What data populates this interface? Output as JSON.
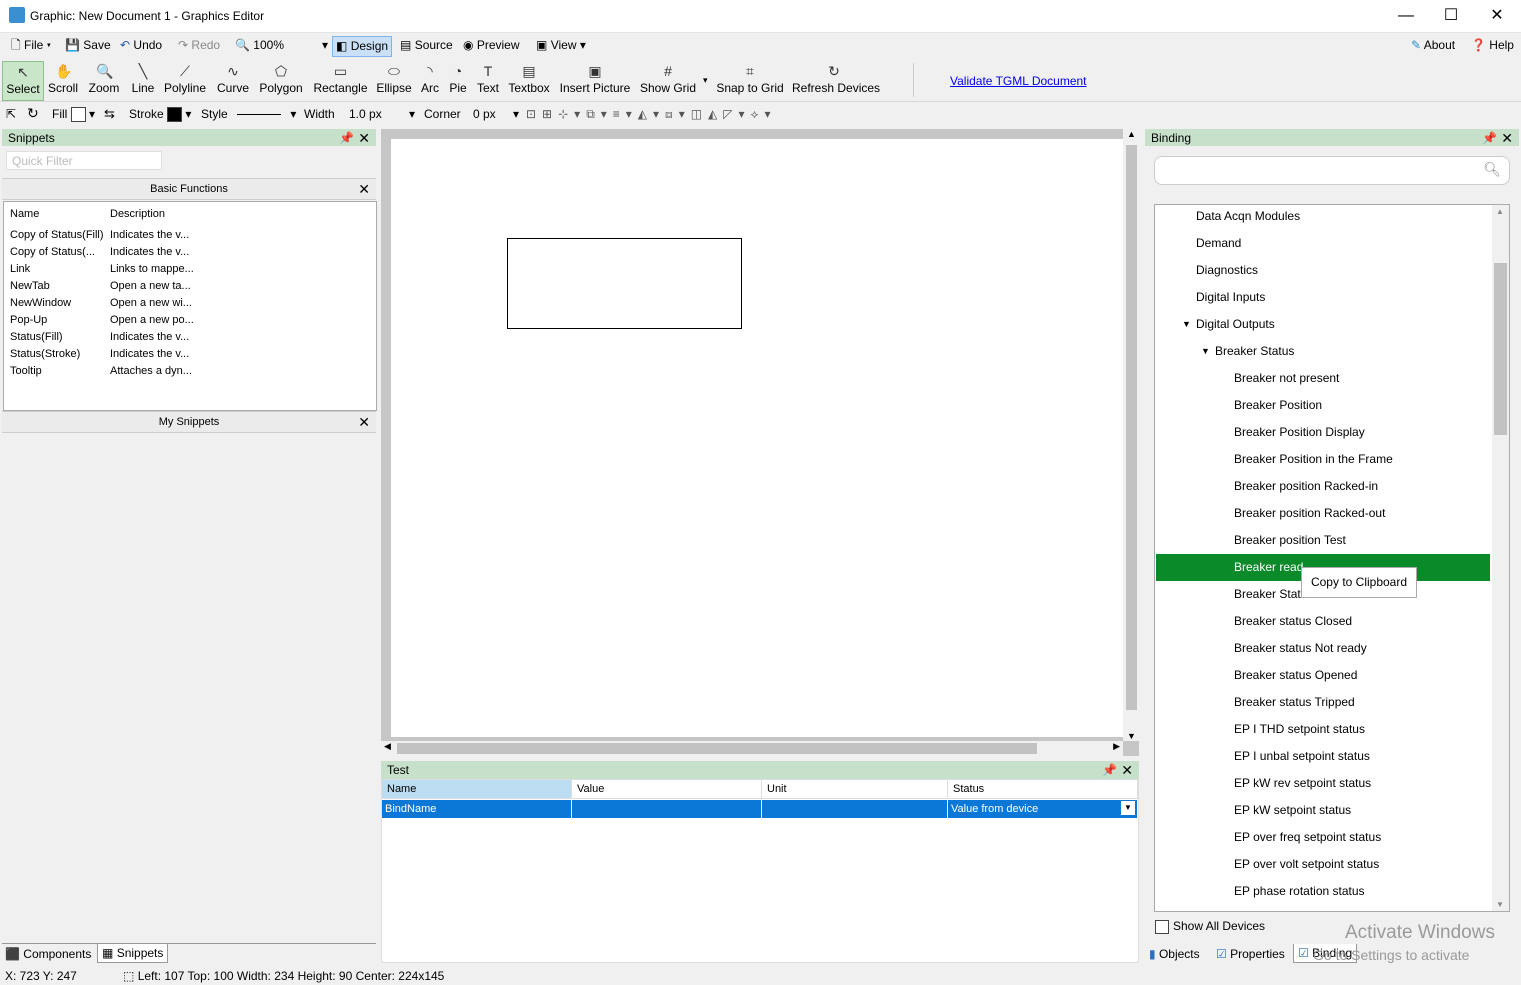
{
  "window": {
    "title": "Graphic: New Document 1 - Graphics Editor",
    "min": "—",
    "max": "☐",
    "close": "✕"
  },
  "menu": {
    "file": "File",
    "save": "Save",
    "undo": "Undo",
    "redo": "Redo",
    "zoom": "100%",
    "design": "Design",
    "source": "Source",
    "preview": "Preview",
    "view": "View",
    "about": "About",
    "help": "Help"
  },
  "tools": [
    {
      "label": "Select",
      "icon": "↖"
    },
    {
      "label": "Scroll",
      "icon": "✋"
    },
    {
      "label": "Zoom",
      "icon": "🔍"
    },
    {
      "label": "Line",
      "icon": "╲"
    },
    {
      "label": "Polyline",
      "icon": "⟋"
    },
    {
      "label": "Curve",
      "icon": "∿"
    },
    {
      "label": "Polygon",
      "icon": "⬠"
    },
    {
      "label": "Rectangle",
      "icon": "▭"
    },
    {
      "label": "Ellipse",
      "icon": "⬭"
    },
    {
      "label": "Arc",
      "icon": "◝"
    },
    {
      "label": "Pie",
      "icon": "◔"
    },
    {
      "label": "Text",
      "icon": "T"
    },
    {
      "label": "Textbox",
      "icon": "▤"
    },
    {
      "label": "Insert Picture",
      "icon": "▣"
    },
    {
      "label": "Show Grid",
      "icon": "#"
    },
    {
      "label": "Snap to Grid",
      "icon": "⌗"
    },
    {
      "label": "Refresh Devices",
      "icon": "↻"
    }
  ],
  "validate_link": "Validate TGML Document",
  "props": {
    "fill": "Fill",
    "stroke": "Stroke",
    "style": "Style",
    "width_label": "Width",
    "width_value": "1.0 px",
    "corner_label": "Corner",
    "corner_value": "0 px"
  },
  "snippets": {
    "title": "Snippets",
    "filter_placeholder": "Quick Filter",
    "basic_functions": "Basic Functions",
    "col_name": "Name",
    "col_desc": "Description",
    "rows": [
      {
        "name": "Copy of Status(Fill)",
        "desc": "Indicates the v..."
      },
      {
        "name": "Copy of Status(...",
        "desc": "Indicates the v..."
      },
      {
        "name": "Link",
        "desc": "Links to mappe..."
      },
      {
        "name": "NewTab",
        "desc": "Open a new ta..."
      },
      {
        "name": "NewWindow",
        "desc": "Open a new wi..."
      },
      {
        "name": "Pop-Up",
        "desc": "Open a new po..."
      },
      {
        "name": "Status(Fill)",
        "desc": "Indicates the v..."
      },
      {
        "name": "Status(Stroke)",
        "desc": "Indicates the v..."
      },
      {
        "name": "Tooltip",
        "desc": "Attaches a dyn..."
      }
    ],
    "my_snippets": "My Snippets"
  },
  "left_tabs": {
    "components": "Components",
    "snippets": "Snippets"
  },
  "test": {
    "title": "Test",
    "cols": [
      "Name",
      "Value",
      "Unit",
      "Status"
    ],
    "row": {
      "name": "BindName",
      "value": "",
      "unit": "",
      "status": "Value from device"
    }
  },
  "binding": {
    "title": "Binding",
    "tree": [
      {
        "label": "Data Acqn Modules",
        "level": 0,
        "expanded": false
      },
      {
        "label": "Demand",
        "level": 0,
        "expanded": false
      },
      {
        "label": "Diagnostics",
        "level": 0,
        "expanded": false
      },
      {
        "label": "Digital Inputs",
        "level": 0,
        "expanded": false
      },
      {
        "label": "Digital Outputs",
        "level": 0,
        "expanded": true
      },
      {
        "label": "Breaker Status",
        "level": 1,
        "expanded": true
      },
      {
        "label": "Breaker not present",
        "level": 2
      },
      {
        "label": "Breaker Position",
        "level": 2
      },
      {
        "label": "Breaker Position Display",
        "level": 2
      },
      {
        "label": "Breaker Position in the Frame",
        "level": 2
      },
      {
        "label": "Breaker position Racked-in",
        "level": 2
      },
      {
        "label": "Breaker position Racked-out",
        "level": 2
      },
      {
        "label": "Breaker position Test",
        "level": 2
      },
      {
        "label": "Breaker read",
        "level": 2,
        "selected": true
      },
      {
        "label": "Breaker Stat",
        "level": 2
      },
      {
        "label": "Breaker status Closed",
        "level": 2
      },
      {
        "label": "Breaker status Not ready",
        "level": 2
      },
      {
        "label": "Breaker status Opened",
        "level": 2
      },
      {
        "label": "Breaker status Tripped",
        "level": 2
      },
      {
        "label": "EP I THD setpoint status",
        "level": 2
      },
      {
        "label": "EP I unbal setpoint status",
        "level": 2
      },
      {
        "label": "EP kW rev setpoint status",
        "level": 2
      },
      {
        "label": "EP kW setpoint status",
        "level": 2
      },
      {
        "label": "EP over freq setpoint status",
        "level": 2
      },
      {
        "label": "EP over volt setpoint status",
        "level": 2
      },
      {
        "label": "EP phase rotation status",
        "level": 2
      }
    ],
    "tooltip": "Copy to Clipboard",
    "show_all_devices": "Show All Devices"
  },
  "right_tabs": {
    "objects": "Objects",
    "properties": "Properties",
    "binding": "Binding"
  },
  "status": {
    "cursor": "X: 723  Y: 247",
    "geometry": "Left: 107  Top: 100  Width: 234  Height: 90  Center: 224x145"
  },
  "watermark": {
    "line1": "Activate Windows",
    "line2": "Go to Settings to activate"
  },
  "colors": {
    "selected_green": "#0a8a28",
    "panel_header": "#c7e0c9",
    "row_blue": "#0b78d7"
  }
}
